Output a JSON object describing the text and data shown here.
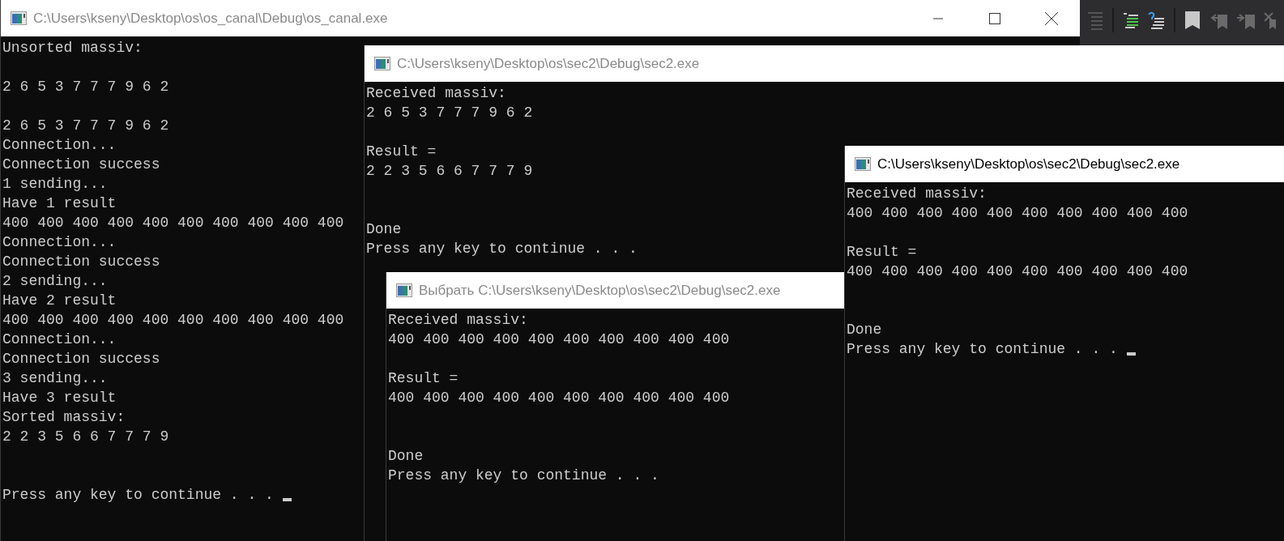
{
  "windows": [
    {
      "title": "C:\\Users\\kseny\\Desktop\\os\\os_canal\\Debug\\os_canal.exe",
      "active": false,
      "caption_buttons": true,
      "cursor": true,
      "lines": [
        {
          "kind": "text",
          "text": "Unsorted massiv:"
        },
        {
          "kind": "blank"
        },
        {
          "kind": "text",
          "text": "2 6 5 3 7 7 7 9 6 2"
        },
        {
          "kind": "blank"
        },
        {
          "kind": "text",
          "text": "2 6 5 3 7 7 7 9 6 2"
        },
        {
          "kind": "text",
          "text": "Connection..."
        },
        {
          "kind": "text",
          "text": "Connection success"
        },
        {
          "kind": "text",
          "text": "1 sending..."
        },
        {
          "kind": "text",
          "text": "Have 1 result"
        },
        {
          "kind": "text",
          "text": "400 400 400 400 400 400 400 400 400 400"
        },
        {
          "kind": "text",
          "text": "Connection..."
        },
        {
          "kind": "text",
          "text": "Connection success"
        },
        {
          "kind": "text",
          "text": "2 sending..."
        },
        {
          "kind": "text",
          "text": "Have 2 result"
        },
        {
          "kind": "text",
          "text": "400 400 400 400 400 400 400 400 400 400"
        },
        {
          "kind": "text",
          "text": "Connection..."
        },
        {
          "kind": "text",
          "text": "Connection success"
        },
        {
          "kind": "text",
          "text": "3 sending..."
        },
        {
          "kind": "text",
          "text": "Have 3 result"
        },
        {
          "kind": "text",
          "text": "Sorted massiv:"
        },
        {
          "kind": "text",
          "text": "2 2 3 5 6 6 7 7 7 9"
        },
        {
          "kind": "blank"
        },
        {
          "kind": "blank"
        },
        {
          "kind": "text",
          "text": "Press any key to continue . . ."
        }
      ]
    },
    {
      "title": "C:\\Users\\kseny\\Desktop\\os\\sec2\\Debug\\sec2.exe",
      "active": false,
      "caption_buttons": false,
      "cursor": false,
      "lines": [
        {
          "kind": "text",
          "text": "Received massiv:"
        },
        {
          "kind": "text",
          "text": "2 6 5 3 7 7 7 9 6 2"
        },
        {
          "kind": "blank"
        },
        {
          "kind": "text",
          "text": "Result ="
        },
        {
          "kind": "text",
          "text": "2 2 3 5 6 6 7 7 7 9"
        },
        {
          "kind": "blank"
        },
        {
          "kind": "blank"
        },
        {
          "kind": "text",
          "text": "Done"
        },
        {
          "kind": "text",
          "text": "Press any key to continue . . ."
        }
      ]
    },
    {
      "title": "Выбрать C:\\Users\\kseny\\Desktop\\os\\sec2\\Debug\\sec2.exe",
      "active": false,
      "caption_buttons": false,
      "cursor": false,
      "lines": [
        {
          "kind": "text",
          "text": "Received massiv:"
        },
        {
          "kind": "text",
          "text": "400 400 400 400 400 400 400 400 400 400"
        },
        {
          "kind": "blank"
        },
        {
          "kind": "text",
          "text": "Result ="
        },
        {
          "kind": "text",
          "text": "400 400 400 400 400 400 400 400 400 400"
        },
        {
          "kind": "blank"
        },
        {
          "kind": "blank"
        },
        {
          "kind": "text",
          "text": "Done"
        },
        {
          "kind": "text",
          "text": "Press any key to continue . . ."
        }
      ]
    },
    {
      "title": "C:\\Users\\kseny\\Desktop\\os\\sec2\\Debug\\sec2.exe",
      "active": true,
      "caption_buttons": false,
      "cursor": true,
      "lines": [
        {
          "kind": "text",
          "text": "Received massiv:"
        },
        {
          "kind": "text",
          "text": "400 400 400 400 400 400 400 400 400 400"
        },
        {
          "kind": "blank"
        },
        {
          "kind": "text",
          "text": "Result ="
        },
        {
          "kind": "text",
          "text": "400 400 400 400 400 400 400 400 400 400"
        },
        {
          "kind": "blank"
        },
        {
          "kind": "blank"
        },
        {
          "kind": "text",
          "text": "Done"
        },
        {
          "kind": "text",
          "text": "Press any key to continue . . ."
        }
      ]
    }
  ]
}
